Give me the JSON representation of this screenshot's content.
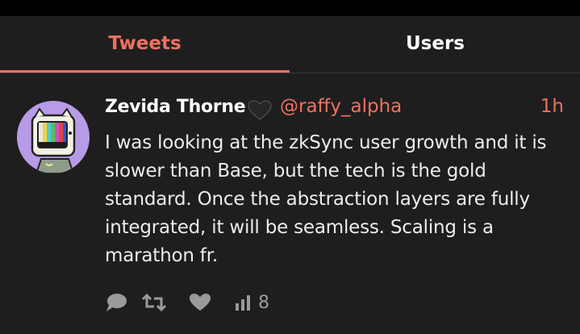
{
  "tabs": [
    {
      "label": "Tweets",
      "active": true
    },
    {
      "label": "Users",
      "active": false
    }
  ],
  "tweet": {
    "author_name": "Zevida Thorne",
    "badge_icon": "black-heart-icon",
    "handle": "@raffy_alpha",
    "time": "1h",
    "text": "I was looking at the zkSync user growth and it is slower than Base, but the tech is the gold standard. Once the abstraction layers are fully integrated, it will be seamless. Scaling is a marathon fr.",
    "actions": {
      "reply_icon": "comment-icon",
      "retweet_icon": "retweet-icon",
      "like_icon": "heart-icon",
      "views_icon": "bar-chart-icon",
      "views_count": "8"
    }
  },
  "colors": {
    "accent": "#f0715f",
    "panel_bg": "#1e1e1e",
    "avatar_bg": "#b79be6",
    "muted": "#9a9a9a"
  }
}
